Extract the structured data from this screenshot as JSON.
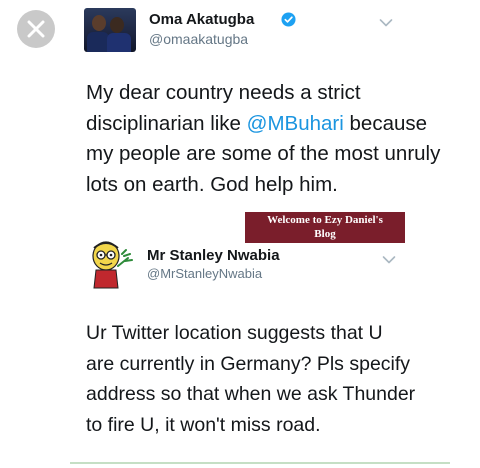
{
  "overlay": {
    "close_icon": "close-icon",
    "close_color": "#c9c9c9"
  },
  "tweet": {
    "author_name": "Oma Akatugba",
    "author_handle": "@omaakatugba",
    "verified_icon": "verified-badge-icon",
    "menu_icon": "chevron-down-icon",
    "text_before": "My dear country needs a strict disciplinarian like ",
    "mention": "@MBuhari",
    "text_after": " because my people are some of the most unruly lots on earth. God help him."
  },
  "watermark": {
    "line1": "Welcome to Ezy Daniel's",
    "line2": "Blog",
    "background": "#7a1e2b"
  },
  "reply": {
    "author_name": "Mr Stanley Nwabia",
    "author_handle": "@MrStanleyNwabia",
    "menu_icon": "chevron-down-icon",
    "text": "Ur Twitter location suggests that U are currently in Germany? Pls specify address so that when we ask Thunder to fire U, it won't miss road."
  },
  "colors": {
    "link": "#1b95e0",
    "secondary_text": "#657786",
    "primary_text": "#14171a",
    "verified": "#1da1f2"
  }
}
